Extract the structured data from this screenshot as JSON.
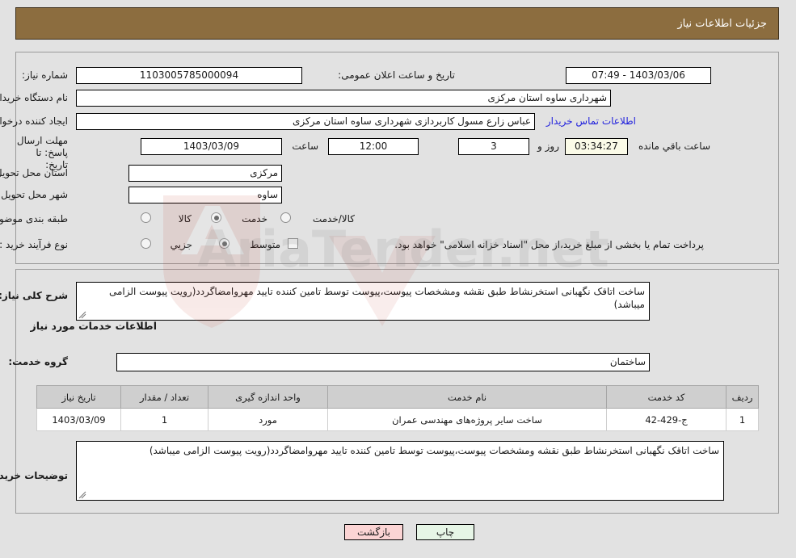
{
  "header": {
    "title": "جزئیات اطلاعات نیاز"
  },
  "top_panel": {
    "need_number_label": "شماره نیاز:",
    "need_number_value": "1103005785000094",
    "public_announce_label": "تاریخ و ساعت اعلان عمومی:",
    "public_announce_value": "1403/03/06 - 07:49",
    "buyer_org_label": "نام دستگاه خریدار:",
    "buyer_org_value": "شهرداری ساوه استان مرکزی",
    "creator_label": "ایجاد کننده درخواست:",
    "creator_value": "عباس زارع مسول کاربردازی شهرداری ساوه استان مرکزی",
    "contact_link": "اطلاعات تماس خریدار",
    "deadline_label": "مهلت ارسال پاسخ: تا تاریخ:",
    "deadline_date": "1403/03/09",
    "hour_label": "ساعت",
    "deadline_time": "12:00",
    "remaining_days": "3",
    "days_and_label": "روز و",
    "remaining_time": "03:34:27",
    "remaining_suffix": "ساعت باقي مانده",
    "delivery_province_label": "استان محل تحویل:",
    "delivery_province_value": "مرکزی",
    "delivery_city_label": "شهر محل تحویل:",
    "delivery_city_value": "ساوه",
    "category_label": "طبقه بندی موضوعی:",
    "category_options": [
      {
        "label": "کالا",
        "selected": false
      },
      {
        "label": "خدمت",
        "selected": true
      },
      {
        "label": "کالا/خدمت",
        "selected": false
      }
    ],
    "process_label": "نوع فرآیند خرید :",
    "process_options": [
      {
        "label": "جزیي",
        "selected": false
      },
      {
        "label": "متوسط",
        "selected": true
      }
    ],
    "treasury_checkbox_checked": false,
    "treasury_text": "پرداخت تمام یا بخشی از مبلغ خرید،از محل \"اسناد خزانه اسلامی\" خواهد بود."
  },
  "description": {
    "label": "شرح کلی نیاز:",
    "value": "ساخت اتاقک نگهبانی استخرنشاط طبق نقشه ومشخصات پیوست،پیوست توسط تامین کننده تایید مهروامضاگردد(رویت پیوست الزامی میباشد)"
  },
  "services_section": {
    "title": "اطلاعات خدمات مورد نیاز",
    "group_label": "گروه خدمت:",
    "group_value": "ساختمان"
  },
  "table": {
    "columns": [
      "ردیف",
      "کد خدمت",
      "نام خدمت",
      "واحد اندازه گیری",
      "تعداد / مقدار",
      "تاریخ نیاز"
    ],
    "rows": [
      {
        "row_no": "1",
        "service_code": "ج-429-42",
        "service_name": "ساخت سایر پروژه‌های مهندسی عمران",
        "unit": "مورد",
        "quantity": "1",
        "need_date": "1403/03/09"
      }
    ]
  },
  "buyer_notes": {
    "label": "توضیحات خریدار:",
    "value": "ساخت اتاقک نگهبانی استخرنشاط طبق نقشه ومشخصات پیوست،پیوست توسط تامین کننده تایید مهروامضاگردد(رویت پیوست الزامی میباشد)"
  },
  "footer": {
    "print_label": "چاپ",
    "back_label": "بازگشت"
  },
  "watermark": {
    "text": "AriaTender.net"
  }
}
